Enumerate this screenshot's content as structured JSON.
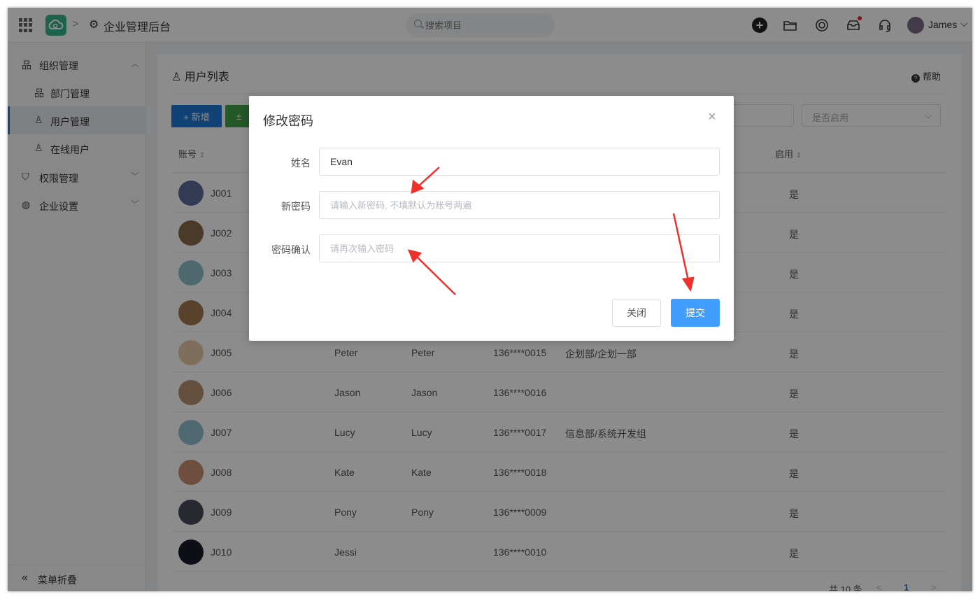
{
  "header": {
    "app_title": "企业管理后台",
    "breadcrumb_sep": ">",
    "search_placeholder": "搜索项目",
    "user_name": "James"
  },
  "sidebar": {
    "groups": [
      {
        "label": "组织管理",
        "icon": "org-icon",
        "expanded": true
      },
      {
        "label": "权限管理",
        "icon": "shield-icon",
        "expanded": false
      },
      {
        "label": "企业设置",
        "icon": "globe-icon",
        "expanded": false
      }
    ],
    "sub_items": [
      {
        "label": "部门管理",
        "icon": "org-icon"
      },
      {
        "label": "用户管理",
        "icon": "user-icon",
        "active": true
      },
      {
        "label": "在线用户",
        "icon": "user-online-icon"
      }
    ],
    "collapse_label": "菜单折叠"
  },
  "content": {
    "title": "用户列表",
    "help_label": "帮助",
    "add_label": "+ 新增",
    "import_label": "±",
    "status_select_placeholder": "是否启用",
    "columns": {
      "account": "账号",
      "enabled": "启用"
    },
    "rows": [
      {
        "account": "J001",
        "name": "",
        "nickname": "",
        "phone": "",
        "dept": "",
        "enabled": "是",
        "avatar_color": "#5b6b9a"
      },
      {
        "account": "J002",
        "name": "",
        "nickname": "",
        "phone": "",
        "dept": "",
        "enabled": "是",
        "avatar_color": "#8a6a4a"
      },
      {
        "account": "J003",
        "name": "",
        "nickname": "",
        "phone": "",
        "dept": "",
        "enabled": "是",
        "avatar_color": "#8fc0c8"
      },
      {
        "account": "J004",
        "name": "",
        "nickname": "",
        "phone": "",
        "dept": "",
        "enabled": "是",
        "avatar_color": "#a07850"
      },
      {
        "account": "J005",
        "name": "Peter",
        "nickname": "Peter",
        "phone": "136****0015",
        "dept": "企划部/企划一部",
        "enabled": "是",
        "avatar_color": "#e8c8a8"
      },
      {
        "account": "J006",
        "name": "Jason",
        "nickname": "Jason",
        "phone": "136****0016",
        "dept": "",
        "enabled": "是",
        "avatar_color": "#b89070"
      },
      {
        "account": "J007",
        "name": "Lucy",
        "nickname": "Lucy",
        "phone": "136****0017",
        "dept": "信息部/系统开发组",
        "enabled": "是",
        "avatar_color": "#90c0d0"
      },
      {
        "account": "J008",
        "name": "Kate",
        "nickname": "Kate",
        "phone": "136****0018",
        "dept": "",
        "enabled": "是",
        "avatar_color": "#c89070"
      },
      {
        "account": "J009",
        "name": "Pony",
        "nickname": "Pony",
        "phone": "136****0009",
        "dept": "",
        "enabled": "是",
        "avatar_color": "#4a4a5a"
      },
      {
        "account": "J010",
        "name": "Jessi",
        "nickname": "",
        "phone": "136****0010",
        "dept": "",
        "enabled": "是",
        "avatar_color": "#1a1a2a"
      }
    ],
    "pager": {
      "total": "共 10 条",
      "prev": "<",
      "page": "1",
      "next": ">"
    }
  },
  "modal": {
    "title": "修改密码",
    "close_icon": "×",
    "name_label": "姓名",
    "name_value": "Evan",
    "new_pw_label": "新密码",
    "new_pw_placeholder": "请输入新密码, 不填默认为账号两遍",
    "confirm_label": "密码确认",
    "confirm_placeholder": "请再次输入密码",
    "close_button": "关闭",
    "submit_button": "提交"
  },
  "colors": {
    "primary": "#409eff",
    "add_button": "#1e78d6",
    "import_button": "#43a047",
    "arrow": "#f0302a"
  }
}
